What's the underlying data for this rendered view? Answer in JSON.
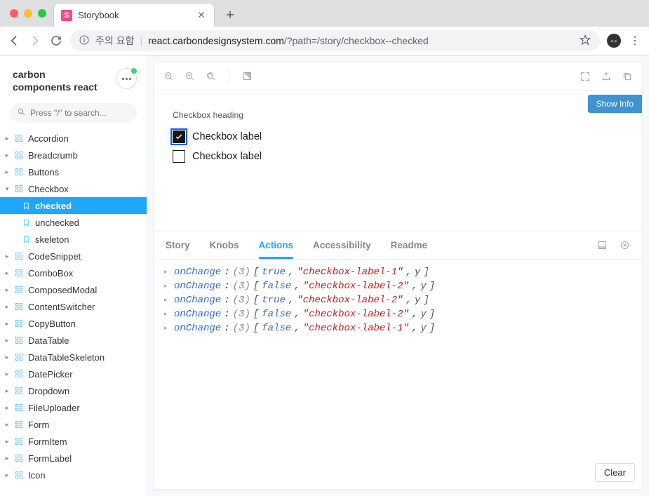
{
  "browser": {
    "tab_title": "Storybook",
    "favicon_letter": "S",
    "url_prefix": "주의 요함",
    "url_host": "react.carbondesignsystem.com",
    "url_path": "/?path=/story/checkbox--checked"
  },
  "brand": "carbon components react",
  "search": {
    "placeholder": "Press \"/\" to search..."
  },
  "tree": {
    "items": [
      {
        "label": "Accordion",
        "expanded": false
      },
      {
        "label": "Breadcrumb",
        "expanded": false
      },
      {
        "label": "Buttons",
        "expanded": false
      },
      {
        "label": "Checkbox",
        "expanded": true,
        "children": [
          {
            "label": "checked",
            "active": true
          },
          {
            "label": "unchecked",
            "active": false
          },
          {
            "label": "skeleton",
            "active": false
          }
        ]
      },
      {
        "label": "CodeSnippet",
        "expanded": false
      },
      {
        "label": "ComboBox",
        "expanded": false
      },
      {
        "label": "ComposedModal",
        "expanded": false
      },
      {
        "label": "ContentSwitcher",
        "expanded": false
      },
      {
        "label": "CopyButton",
        "expanded": false
      },
      {
        "label": "DataTable",
        "expanded": false
      },
      {
        "label": "DataTableSkeleton",
        "expanded": false
      },
      {
        "label": "DatePicker",
        "expanded": false
      },
      {
        "label": "Dropdown",
        "expanded": false
      },
      {
        "label": "FileUploader",
        "expanded": false
      },
      {
        "label": "Form",
        "expanded": false
      },
      {
        "label": "FormItem",
        "expanded": false
      },
      {
        "label": "FormLabel",
        "expanded": false
      },
      {
        "label": "Icon",
        "expanded": false
      }
    ]
  },
  "preview": {
    "show_info": "Show Info",
    "heading": "Checkbox heading",
    "checkboxes": [
      {
        "label": "Checkbox label",
        "checked": true
      },
      {
        "label": "Checkbox label",
        "checked": false
      }
    ]
  },
  "addons": {
    "tabs": [
      "Story",
      "Knobs",
      "Actions",
      "Accessibility",
      "Readme"
    ],
    "active": "Actions",
    "clear": "Clear",
    "logs": [
      {
        "fn": "onChange",
        "count": 3,
        "args": [
          "true",
          "\"checkbox-label-1\"",
          "y"
        ]
      },
      {
        "fn": "onChange",
        "count": 3,
        "args": [
          "false",
          "\"checkbox-label-2\"",
          "y"
        ]
      },
      {
        "fn": "onChange",
        "count": 3,
        "args": [
          "true",
          "\"checkbox-label-2\"",
          "y"
        ]
      },
      {
        "fn": "onChange",
        "count": 3,
        "args": [
          "false",
          "\"checkbox-label-2\"",
          "y"
        ]
      },
      {
        "fn": "onChange",
        "count": 3,
        "args": [
          "false",
          "\"checkbox-label-1\"",
          "y"
        ]
      }
    ]
  }
}
